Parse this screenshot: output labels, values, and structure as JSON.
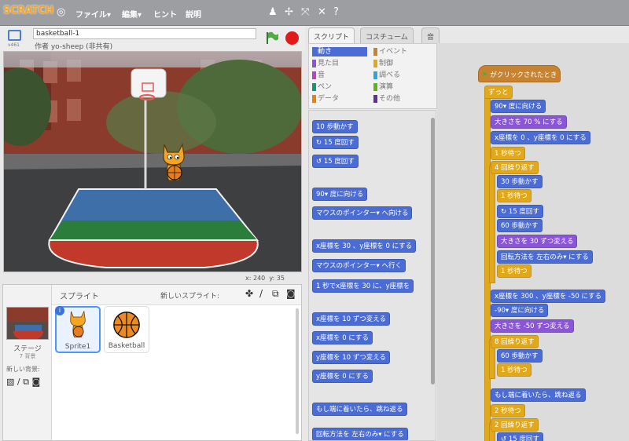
{
  "app": {
    "logo": "SCRATCH"
  },
  "menu": {
    "file": "ファイル▾",
    "edit": "編集▾",
    "hint": "ヒント",
    "about": "説明"
  },
  "project": {
    "title": "basketball-1",
    "author": "作者 yo-sheep (非共有)"
  },
  "stage": {
    "coords_x": "x: 240",
    "coords_y": "y: 35"
  },
  "sprites": {
    "header": "スプライト",
    "new_sprite": "新しいスプライト:",
    "stage_label": "ステージ",
    "stage_bg_count": "7 背景",
    "new_backdrop": "新しい背景:",
    "items": [
      {
        "name": "Sprite1",
        "badge": "i"
      },
      {
        "name": "Basketball"
      }
    ]
  },
  "tabs": [
    "スクリプト",
    "コスチューム",
    "音"
  ],
  "categories": [
    {
      "label": "動き",
      "color": "#4a6cd4",
      "selected": true
    },
    {
      "label": "見た目",
      "color": "#8a55d7"
    },
    {
      "label": "音",
      "color": "#bb42c3"
    },
    {
      "label": "ペン",
      "color": "#0e9a6c"
    },
    {
      "label": "データ",
      "color": "#ee7d16"
    },
    {
      "label": "イベント",
      "color": "#c88330"
    },
    {
      "label": "制御",
      "color": "#e1a91a"
    },
    {
      "label": "調べる",
      "color": "#2ca5e2"
    },
    {
      "label": "演算",
      "color": "#5cb712"
    },
    {
      "label": "その他",
      "color": "#632d99"
    }
  ],
  "palette": [
    "10 歩動かす",
    "↻ 15 度回す",
    "↺ 15 度回す",
    "90▾ 度に向ける",
    "マウスのポインター▾ へ向ける",
    "x座標を 30 、y座標を 0 にする",
    "マウスのポインター▾ へ行く",
    "1 秒でx座標を 30 に、y座標を",
    "x座標を 10 ずつ変える",
    "x座標を 0 にする",
    "y座標を 10 ずつ変える",
    "y座標を 0 にする",
    "もし端に着いたら、跳ね返る",
    "回転方法を 左右のみ▾ にする"
  ],
  "script": [
    "がクリックされたとき",
    "ずっと",
    "90▾ 度に向ける",
    "大きさを 70 % にする",
    "x座標を 0 、y座標を 0 にする",
    "1 秒待つ",
    "4 回繰り返す",
    "30 歩動かす",
    "1 秒待つ",
    "↻ 15 度回す",
    "60 歩動かす",
    "大きさを 30 ずつ変える",
    "回転方法を 左右のみ▾ にする",
    "1 秒待つ",
    "x座標を 300 、y座標を -50 にする",
    "-90▾ 度に向ける",
    "大きさを -50 ずつ変える",
    "8 回繰り返す",
    "60 歩動かす",
    "1 秒待つ",
    "もし端に着いたら、跳ね返る",
    "2 秒待つ",
    "2 回繰り返す",
    "↺ 15 度回す"
  ]
}
